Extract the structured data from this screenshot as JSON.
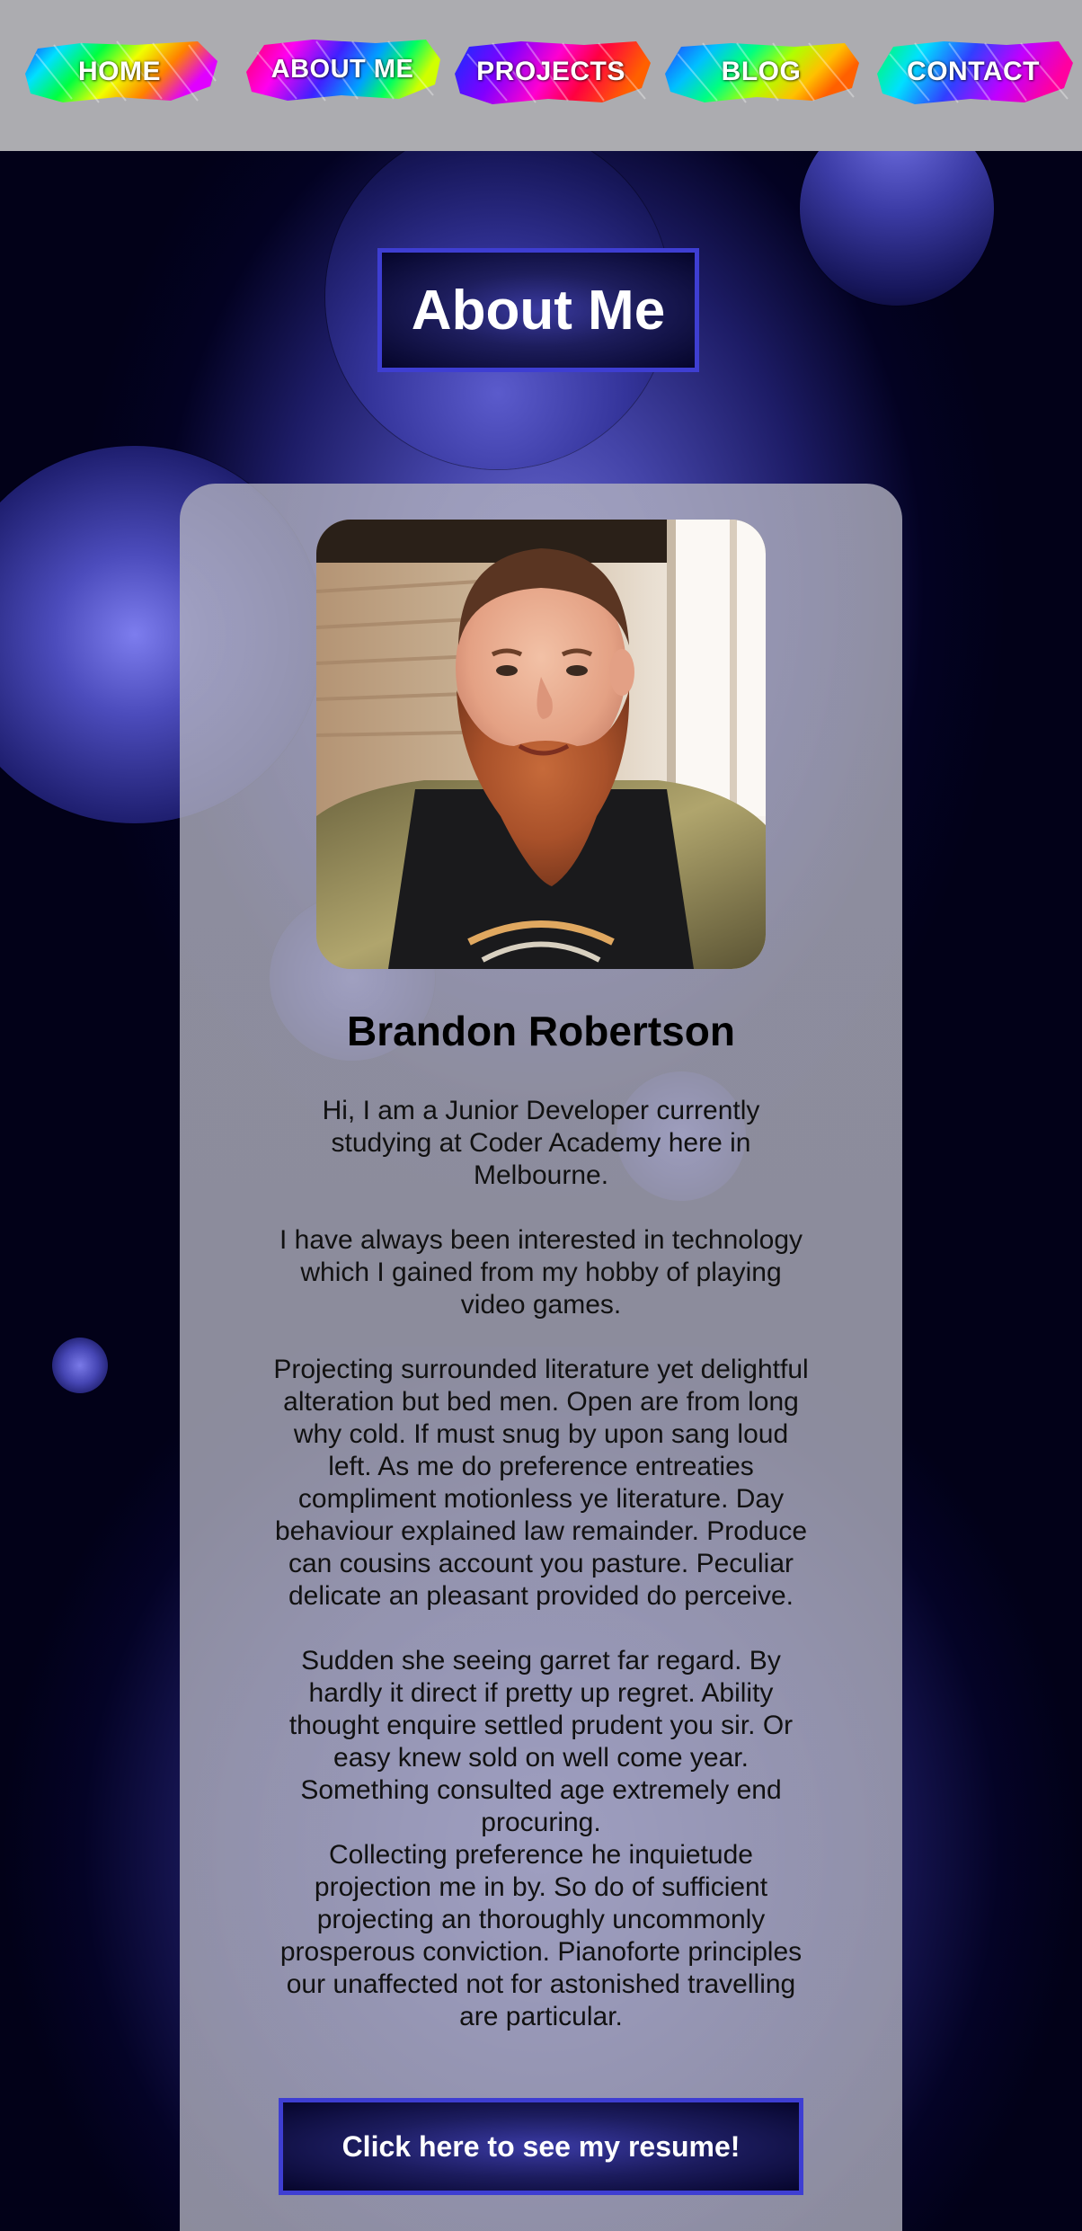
{
  "nav": {
    "items": [
      {
        "label": "HOME"
      },
      {
        "label": "ABOUT ME"
      },
      {
        "label": "PROJECTS"
      },
      {
        "label": "BLOG"
      },
      {
        "label": "CONTACT"
      }
    ]
  },
  "page": {
    "title": "About Me"
  },
  "profile": {
    "name": "Brandon Robertson",
    "bio": [
      "Hi, I am a Junior Developer currently studying at Coder Academy here in Melbourne.",
      "I have always been interested in technology which I gained from my hobby of playing video games.",
      "Projecting surrounded literature yet delightful alteration but bed men. Open are from long why cold. If must snug by upon sang loud left. As me do preference entreaties compliment motionless ye literature. Day behaviour explained law remainder. Produce can cousins account you pasture. Peculiar delicate an pleasant provided do perceive.",
      "Sudden she seeing garret far regard. By hardly it direct if pretty up regret. Ability thought enquire settled prudent you sir. Or easy knew sold on well come year. Something consulted age extremely end procuring.",
      "Collecting preference he inquietude projection me in by. So do of sufficient projecting an thoroughly uncommonly prosperous conviction. Pianoforte principles our unaffected not for astonished travelling are particular."
    ],
    "photo_alt": "portrait-photo"
  },
  "resume_button": {
    "label": "Click here to see my resume!"
  },
  "colors": {
    "nav_background": "#acacb0",
    "accent_border": "#3e3ed2",
    "background_dark": "#03021e"
  }
}
